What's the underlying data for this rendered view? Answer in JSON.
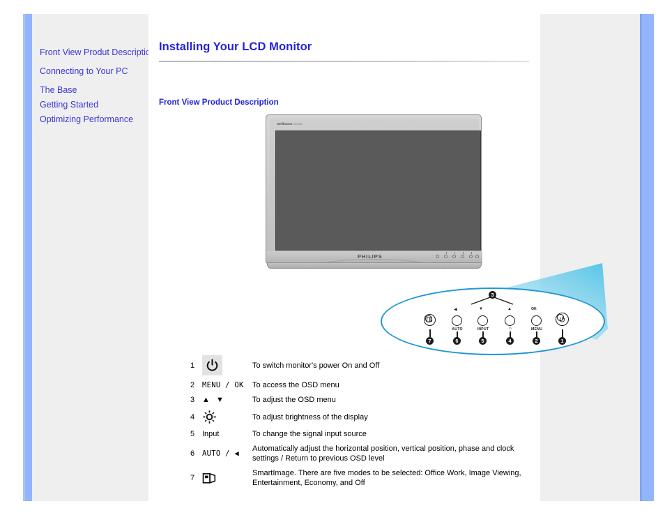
{
  "colors": {
    "accent_blue": "#93b5fb",
    "link_blue": "#3a36d6",
    "title_blue": "#2222dd",
    "callout_stroke": "#2196d8",
    "panel_gray": "#efefef",
    "screen_gray": "#5a5a5a"
  },
  "sidebar": {
    "items": [
      {
        "label": "Front View Produt Description",
        "name": "front-view-produt-description"
      },
      {
        "label": "Connecting to Your PC",
        "name": "connecting-to-your-pc"
      },
      {
        "label": "The Base",
        "name": "the-base"
      },
      {
        "label": "Getting Started",
        "name": "getting-started"
      },
      {
        "label": "Optimizing Performance",
        "name": "optimizing-performance"
      }
    ]
  },
  "main": {
    "page_title": "Installing Your LCD Monitor",
    "section_heading": "Front View Product Description"
  },
  "monitor": {
    "brand_top": "Brilliance",
    "brand_top_sub": "220CW",
    "brand_bottom": "PHILIPS"
  },
  "callout": {
    "buttons": [
      {
        "badge": "7",
        "icon": "smartimage-icon",
        "top_mark": "",
        "label": ""
      },
      {
        "badge": "6",
        "icon": "auto-button",
        "top_mark": "◀",
        "label": "AUTO"
      },
      {
        "badge": "5",
        "icon": "input-button",
        "top_mark": "▼",
        "label": "INPUT"
      },
      {
        "badge": "4",
        "icon": "brightness-button",
        "top_mark": "▲",
        "label": "☼"
      },
      {
        "badge": "2",
        "icon": "menu-button",
        "top_mark": "OK",
        "label": "MENU"
      },
      {
        "badge": "1",
        "icon": "power-button",
        "top_mark": "",
        "label": ""
      }
    ],
    "group_badge": "3"
  },
  "legend": {
    "rows": [
      {
        "num": "1",
        "icon_kind": "power",
        "icon_text": "⏻",
        "desc": "To switch monitor's power On and Off"
      },
      {
        "num": "2",
        "icon_kind": "mono",
        "icon_text": "MENU / OK",
        "desc": "To access the OSD menu"
      },
      {
        "num": "3",
        "icon_kind": "arrows",
        "icon_text": "▲ ▼",
        "desc": "To adjust the OSD menu"
      },
      {
        "num": "4",
        "icon_kind": "brightness",
        "icon_text": "☼",
        "desc": "To adjust brightness of the display"
      },
      {
        "num": "5",
        "icon_kind": "plain",
        "icon_text": "Input",
        "desc": "To change the signal input source"
      },
      {
        "num": "6",
        "icon_kind": "mono",
        "icon_text": "AUTO / ◀",
        "desc": "Automatically adjust the horizontal position, vertical position, phase and clock settings / Return to previous OSD level"
      },
      {
        "num": "7",
        "icon_kind": "smartimage",
        "icon_text": "",
        "desc": "SmartImage. There are five modes to be selected: Office Work, Image Viewing, Entertainment, Economy, and Off"
      }
    ]
  }
}
